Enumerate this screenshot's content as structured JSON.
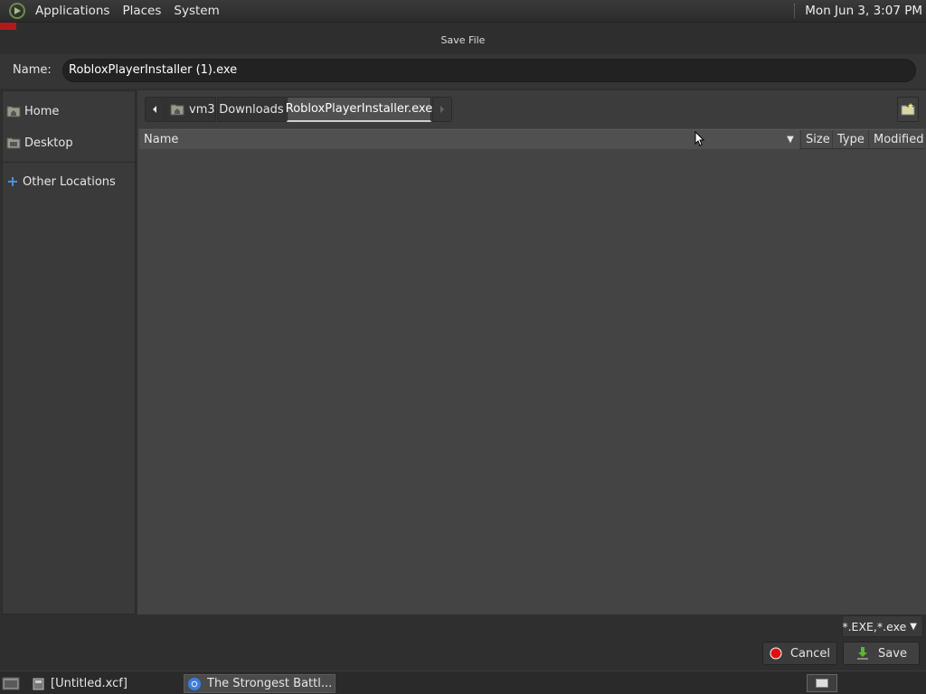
{
  "top_panel": {
    "menus": [
      "Applications",
      "Places",
      "System"
    ],
    "clock": "Mon Jun  3,  3:07 PM"
  },
  "dialog": {
    "title": "Save File",
    "name_label": "Name:",
    "name_value": "RobloxPlayerInstaller (1).exe"
  },
  "sidebar": {
    "items": [
      {
        "label": "Home",
        "icon": "home-folder-icon"
      },
      {
        "label": "Desktop",
        "icon": "desktop-folder-icon"
      },
      {
        "label": "Other Locations",
        "icon": "plus-icon"
      }
    ]
  },
  "pathbar": {
    "crumbs": [
      "vm3",
      "Downloads",
      "RobloxPlayerInstaller.exe"
    ]
  },
  "columns": {
    "name": "Name",
    "size": "Size",
    "type": "Type",
    "modified": "Modified"
  },
  "filter": "*.EXE,*.exe",
  "buttons": {
    "cancel": "Cancel",
    "save": "Save"
  },
  "taskbar": {
    "tasks": [
      "[Untitled.xcf]",
      "The Strongest Battl..."
    ]
  },
  "colors": {
    "cancel_icon": "#e01010",
    "save_icon": "#5db62f",
    "accent_red": "#b11a1a"
  }
}
